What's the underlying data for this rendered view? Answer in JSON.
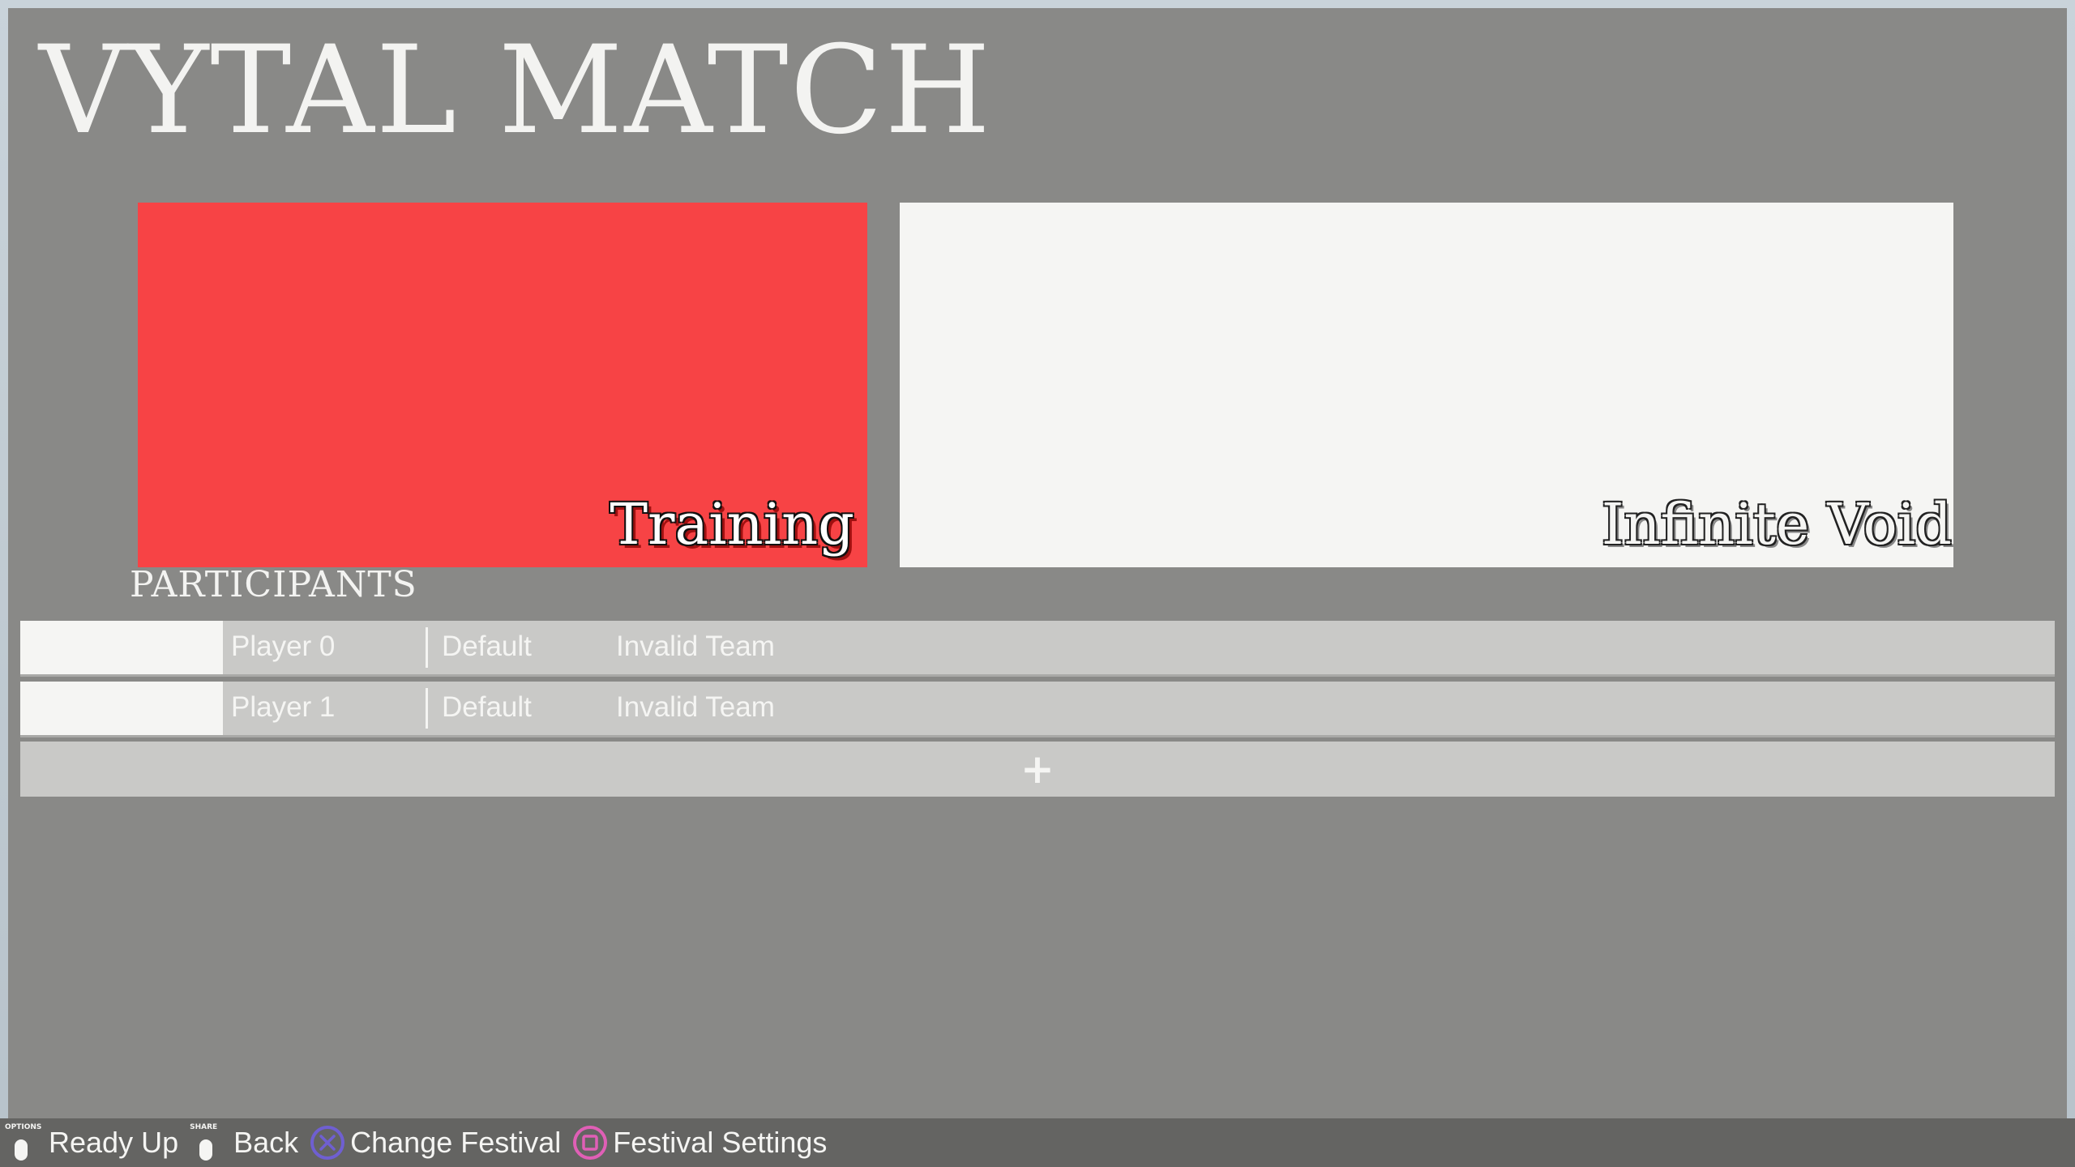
{
  "title": "VYTAL MATCH",
  "mode_card": {
    "label": "Training",
    "color": "#f74345"
  },
  "stage_card": {
    "label": "Infinite Void",
    "color": "#f5f5f3"
  },
  "participants": {
    "heading": "PARTICIPANTS",
    "rows": [
      {
        "name": "Player 0",
        "costume": "Default",
        "team": "Invalid Team"
      },
      {
        "name": "Player 1",
        "costume": "Default",
        "team": "Invalid Team"
      }
    ],
    "add_label": "+"
  },
  "footer": {
    "hints": [
      {
        "button_caption": "OPTIONS",
        "icon": "options-button-icon",
        "label": "Ready Up"
      },
      {
        "button_caption": "SHARE",
        "icon": "share-button-icon",
        "label": "Back"
      },
      {
        "icon": "cross-button-icon",
        "label": "Change Festival",
        "color": "#6f5fd1"
      },
      {
        "icon": "square-button-icon",
        "label": "Festival Settings",
        "color": "#e05fb6"
      }
    ]
  }
}
